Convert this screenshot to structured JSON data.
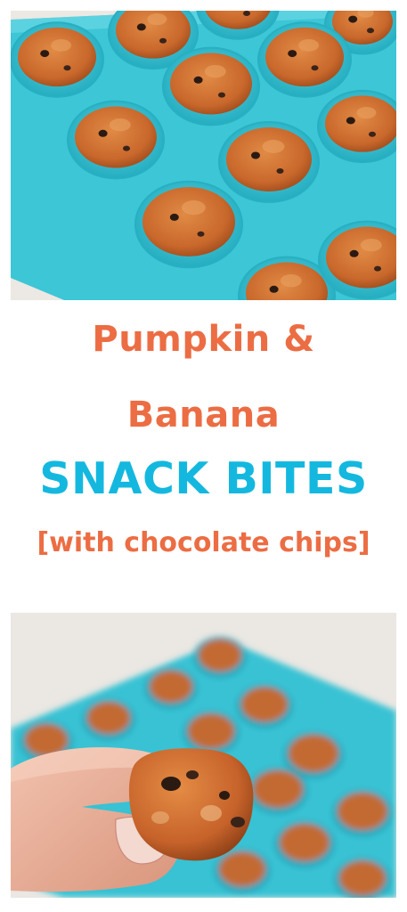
{
  "headline": {
    "line1": "Pumpkin &",
    "line2": "Banana",
    "line3": "SNACK BITES",
    "line4": "[with chocolate chips]"
  },
  "colors": {
    "orange_text": "#ec6d43",
    "blue_text": "#14b8df",
    "tray": "#3cc6d6",
    "bite": "#c9682c"
  }
}
